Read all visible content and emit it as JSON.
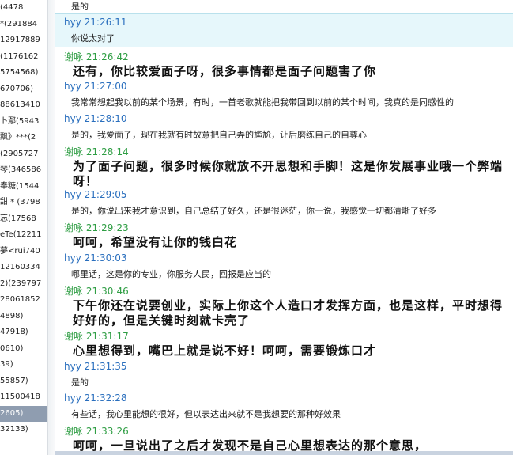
{
  "contacts": [
    "(4478",
    "*(291884",
    "12917889",
    "(1176162",
    "5754568)",
    "670706)",
    "88613410",
    "卜鄢(5943",
    "飘》***(2",
    "(2905727",
    "琴(346586",
    "奉糖(1544",
    "甜 * (3798",
    "忘(17568",
    "eTe(12211",
    "夢<rui740",
    "12160334",
    "2)(239797",
    "28061852",
    "4898)",
    "47918)",
    "0610)",
    "39)",
    "55857)",
    "11500418",
    "2605)",
    "32133)",
    ""
  ],
  "selected_contact_index": 25,
  "chat": {
    "first_line": "是的",
    "messages": [
      {
        "sender": "hyy",
        "time": "21:26:11",
        "text": "你说太对了",
        "style": "normal",
        "highlight": true
      },
      {
        "sender": "谢咏",
        "time": "21:26:42",
        "text": "还有，你比较爱面子呀，很多事情都是面子问题害了你",
        "style": "big"
      },
      {
        "sender": "hyy",
        "time": "21:27:00",
        "text": "我常常想起我以前的某个场景，有时，一首老歌就能把我带回到以前的某个时间，我真的是同感性的",
        "style": "normal"
      },
      {
        "sender": "hyy",
        "time": "21:28:10",
        "text": "是的，我爱面子，现在我就有时故意把自己弄的尴尬，让后磨练自己的自尊心",
        "style": "normal"
      },
      {
        "sender": "谢咏",
        "time": "21:28:14",
        "text": "为了面子问题，很多时候你就放不开思想和手脚！这是你发展事业哦一个弊端呀！",
        "style": "big"
      },
      {
        "sender": "hyy",
        "time": "21:29:05",
        "text": "是的，你说出来我才意识到，自己总结了好久，还是很迷茫，你一说，我感觉一切都清晰了好多",
        "style": "normal"
      },
      {
        "sender": "谢咏",
        "time": "21:29:23",
        "text": "呵呵，希望没有让你的钱白花",
        "style": "big"
      },
      {
        "sender": "hyy",
        "time": "21:30:03",
        "text": "哪里话，这是你的专业，你服务人民，回报是应当的",
        "style": "normal"
      },
      {
        "sender": "谢咏",
        "time": "21:30:46",
        "text": "下午你还在说要创业，实际上你这个人造口才发挥方面，也是这样，平时想得好好的，但是关键时刻就卡壳了",
        "style": "big"
      },
      {
        "sender": "谢咏",
        "time": "21:31:17",
        "text": "心里想得到，嘴巴上就是说不好！呵呵，需要锻炼口才",
        "style": "big"
      },
      {
        "sender": "hyy",
        "time": "21:31:35",
        "text": "是的",
        "style": "normal"
      },
      {
        "sender": "hyy",
        "time": "21:32:28",
        "text": "有些话，我心里能想的很好，但以表达出来就不是我想要的那种好效果",
        "style": "normal"
      },
      {
        "sender": "谢咏",
        "time": "21:33:26",
        "text": "呵呵，一旦说出了之后才发现不是自己心里想表达的那个意思，",
        "style": "big"
      }
    ]
  },
  "colors": {
    "hyy_name": "#2a6fbe",
    "xieyong_name": "#2f9e44",
    "highlight_bg": "#e6f7fb",
    "selected_contact_bg": "#8f9db0"
  }
}
